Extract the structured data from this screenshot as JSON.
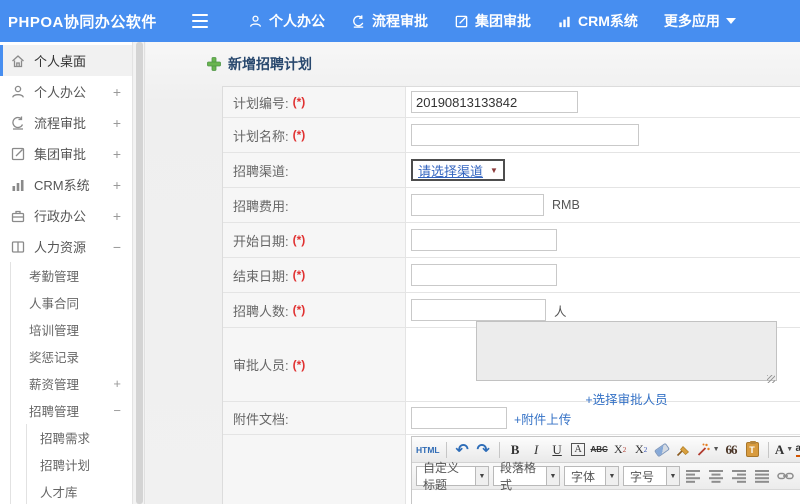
{
  "header": {
    "brand": "PHPOA协同办公软件",
    "nav": [
      {
        "label": "个人办公",
        "icon": "person-icon"
      },
      {
        "label": "流程审批",
        "icon": "process-icon"
      },
      {
        "label": "集团审批",
        "icon": "edit-square-icon"
      },
      {
        "label": "CRM系统",
        "icon": "bar-chart-icon"
      },
      {
        "label": "更多应用",
        "icon": "caret-down-icon"
      }
    ]
  },
  "sidebar": {
    "items": [
      {
        "label": "个人桌面",
        "icon": "home-icon",
        "active": true
      },
      {
        "label": "个人办公",
        "icon": "person-icon",
        "toggle": "+"
      },
      {
        "label": "流程审批",
        "icon": "process-icon",
        "toggle": "+"
      },
      {
        "label": "集团审批",
        "icon": "edit-square-icon",
        "toggle": "+"
      },
      {
        "label": "CRM系统",
        "icon": "bar-chart-icon",
        "toggle": "+"
      },
      {
        "label": "行政办公",
        "icon": "briefcase-icon",
        "toggle": "+"
      },
      {
        "label": "人力资源",
        "icon": "book-icon",
        "toggle": "−"
      }
    ],
    "hr_submenu": [
      {
        "label": "考勤管理"
      },
      {
        "label": "人事合同"
      },
      {
        "label": "培训管理"
      },
      {
        "label": "奖惩记录"
      },
      {
        "label": "薪资管理",
        "toggle": "+"
      },
      {
        "label": "招聘管理",
        "toggle": "−"
      }
    ],
    "recruit_submenu": [
      {
        "label": "招聘需求"
      },
      {
        "label": "招聘计划"
      },
      {
        "label": "人才库"
      }
    ]
  },
  "main": {
    "title": "新增招聘计划",
    "form": {
      "rows": [
        {
          "label": "计划编号:",
          "required": "(*)",
          "value": "20190813133842"
        },
        {
          "label": "计划名称:",
          "required": "(*)"
        },
        {
          "label": "招聘渠道:",
          "select_value": "请选择渠道"
        },
        {
          "label": "招聘费用:",
          "suffix": "RMB"
        },
        {
          "label": "开始日期:",
          "required": "(*)"
        },
        {
          "label": "结束日期:",
          "required": "(*)"
        },
        {
          "label": "招聘人数:",
          "required": "(*)",
          "suffix": "人"
        },
        {
          "label": "审批人员:",
          "required": "(*)",
          "link": "+选择审批人员"
        },
        {
          "label": "附件文档:",
          "link": "+附件上传"
        }
      ]
    }
  },
  "editor": {
    "html_label": "HTML",
    "bold": "B",
    "italic": "I",
    "underline": "U",
    "border_text": "A",
    "strike": "ABC",
    "sup_base": "X",
    "sup_digit": "2",
    "sub_base": "X",
    "sub_digit": "2",
    "quote": "66",
    "paste_letter": "T",
    "font_color_letter": "A",
    "highlight_letters": "ab",
    "dropdowns": [
      {
        "label": "自定义标题"
      },
      {
        "label": "段落格式"
      },
      {
        "label": "字体"
      },
      {
        "label": "字号"
      }
    ]
  },
  "icons": {
    "caret_down": "▼",
    "undo": "↶",
    "redo": "↷"
  },
  "colors": {
    "header_blue": "#478ef0",
    "link_blue": "#3572c6",
    "required_red": "#e03131",
    "title_navy": "#28486e",
    "add_green": "#5cb85c"
  }
}
